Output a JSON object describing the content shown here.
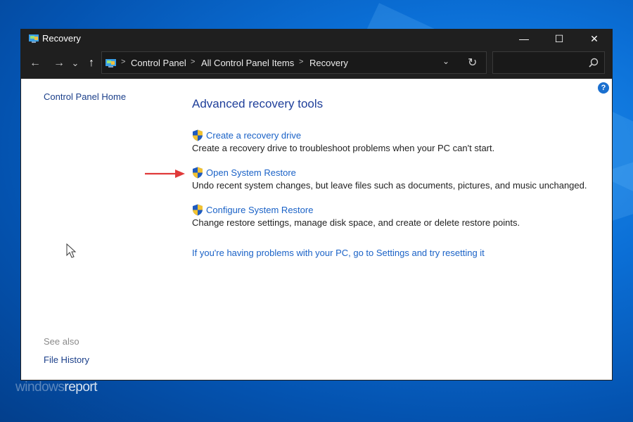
{
  "window": {
    "title": "Recovery",
    "controls": {
      "minimize": "—",
      "maximize": "☐",
      "close": "✕"
    }
  },
  "navigation": {
    "back": "←",
    "forward": "→",
    "recent": "⌄",
    "up": "↑",
    "breadcrumb": [
      "Control Panel",
      "All Control Panel Items",
      "Recovery"
    ],
    "separator": ">",
    "dropdown": "⌄",
    "refresh": "↻",
    "search_placeholder": ""
  },
  "sidebar": {
    "home_link": "Control Panel Home",
    "see_also_label": "See also",
    "see_also_links": [
      "File History"
    ]
  },
  "main": {
    "heading": "Advanced recovery tools",
    "items": [
      {
        "link": "Create a recovery drive",
        "description": "Create a recovery drive to troubleshoot problems when your PC can't start."
      },
      {
        "link": "Open System Restore",
        "description": "Undo recent system changes, but leave files such as documents, pictures, and music unchanged."
      },
      {
        "link": "Configure System Restore",
        "description": "Change restore settings, manage disk space, and create or delete restore points."
      }
    ],
    "reset_link": "If you're having problems with your PC, go to Settings and try resetting it"
  },
  "help": {
    "label": "?"
  },
  "watermark": {
    "part1": "windows",
    "part2": "report"
  },
  "colors": {
    "titlebar": "#1f1f1f",
    "link": "#1a62c7",
    "heading": "#1f3f9a",
    "arrow": "#e03a3a",
    "desktop": "#0b6fd6"
  },
  "icons": {
    "window_icon": "control-panel-icon",
    "shield": "uac-shield-icon",
    "search": "search-icon",
    "help": "help-icon"
  }
}
